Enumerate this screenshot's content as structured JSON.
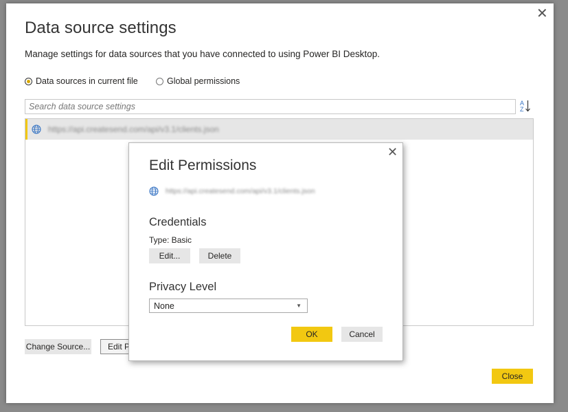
{
  "main_dialog": {
    "title": "Data source settings",
    "subtitle": "Manage settings for data sources that you have connected to using Power BI Desktop.",
    "radio_options": [
      {
        "label": "Data sources in current file",
        "selected": true
      },
      {
        "label": "Global permissions",
        "selected": false
      }
    ],
    "search": {
      "placeholder": "Search data source settings",
      "value": ""
    },
    "data_sources": [
      {
        "url": "https://api.createsend.com/api/v3.1/clients.json",
        "icon": "globe-icon"
      }
    ],
    "buttons": {
      "change_source": "Change Source...",
      "edit_permissions": "Edit Pe",
      "close": "Close"
    }
  },
  "edit_permissions_dialog": {
    "title": "Edit Permissions",
    "url": "https://api.createsend.com/api/v3.1/clients.json",
    "credentials": {
      "heading": "Credentials",
      "type_label": "Type: Basic",
      "edit_button": "Edit...",
      "delete_button": "Delete"
    },
    "privacy": {
      "heading": "Privacy Level",
      "selected": "None"
    },
    "buttons": {
      "ok": "OK",
      "cancel": "Cancel"
    }
  },
  "colors": {
    "accent": "#f2c811",
    "overlay": "#8a8a8a",
    "selected_row": "#e6e6e6",
    "globe_blue": "#3a76c4"
  }
}
